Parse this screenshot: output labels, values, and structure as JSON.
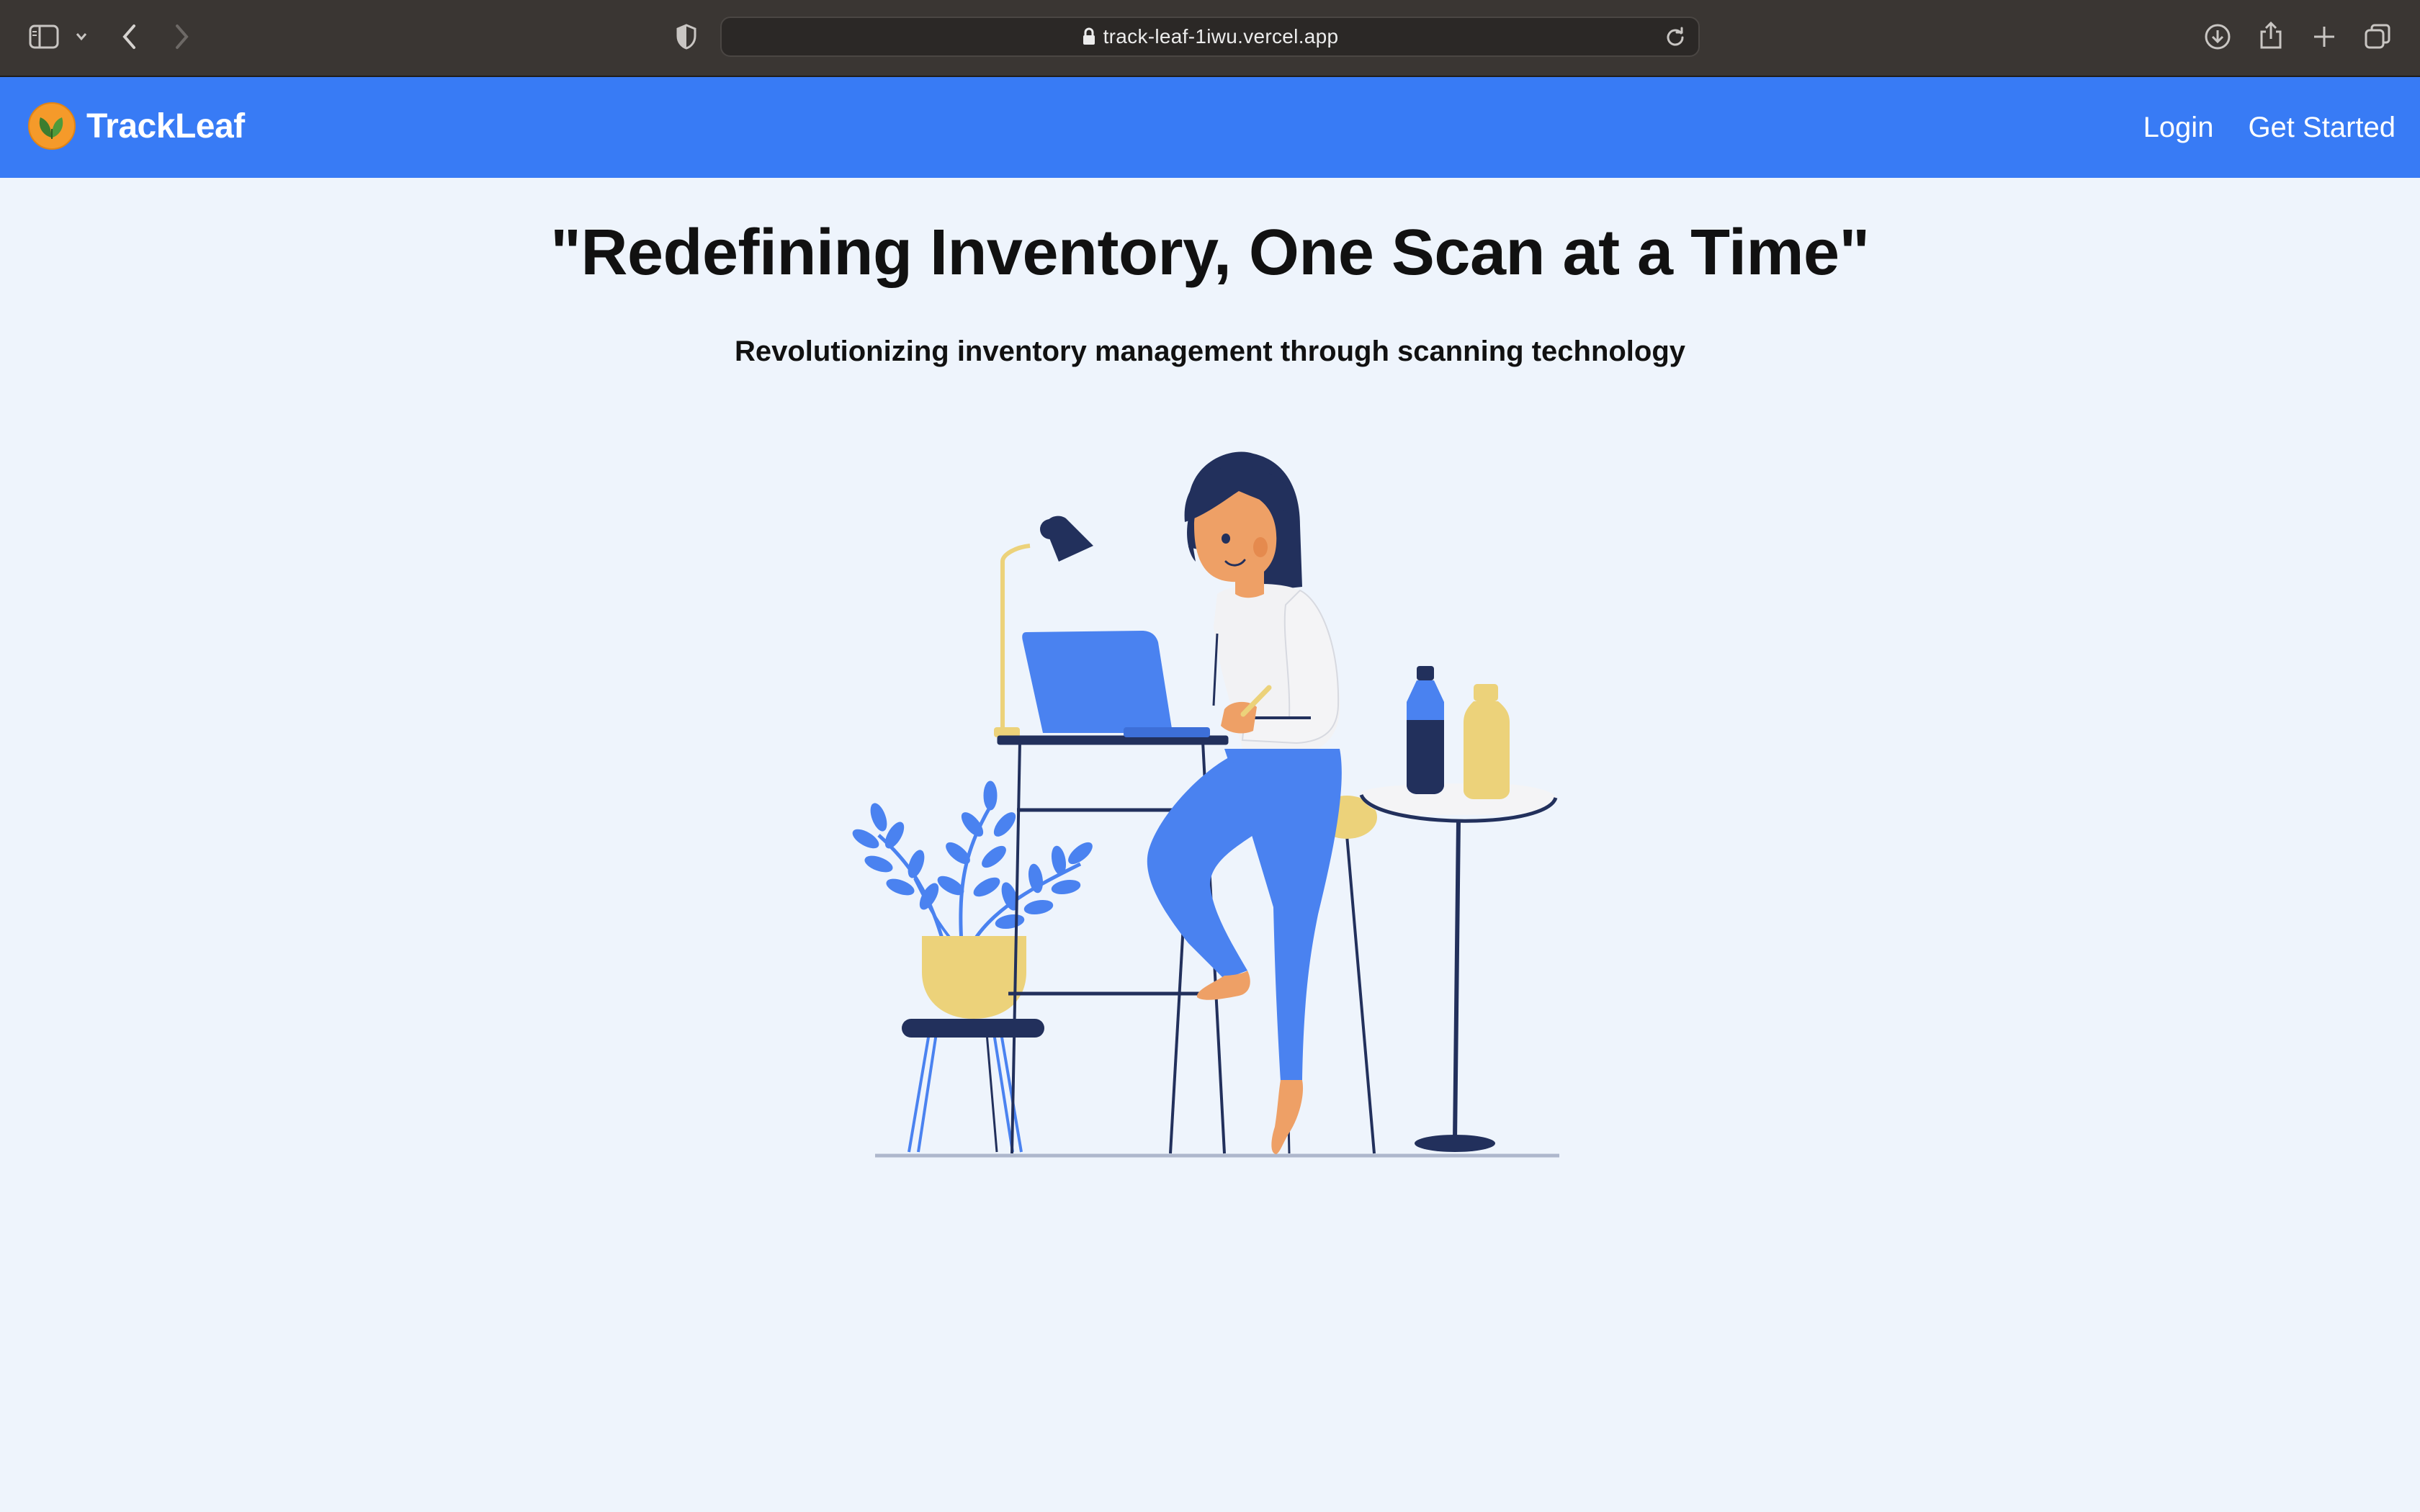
{
  "browser": {
    "url": "track-leaf-1iwu.vercel.app",
    "icons": [
      "sidebar-icon",
      "chevron-down-icon",
      "back-icon",
      "forward-icon",
      "shield-icon",
      "lock-icon",
      "reload-icon",
      "download-icon",
      "share-icon",
      "new-tab-icon",
      "tabs-overview-icon"
    ]
  },
  "header": {
    "brand": "TrackLeaf",
    "nav": {
      "login": "Login",
      "get_started": "Get Started"
    },
    "colors": {
      "background": "#387bf5",
      "text": "#ffffff"
    }
  },
  "hero": {
    "title": "\"Redefining Inventory, One Scan at a Time\"",
    "subtitle": "Revolutionizing inventory management through scanning technology",
    "illustration": "woman-with-laptop-illustration"
  },
  "colors": {
    "page_background": "#eef4fc",
    "accent_blue": "#4a82f0",
    "navy": "#22305c",
    "yellow": "#ecd27a"
  }
}
